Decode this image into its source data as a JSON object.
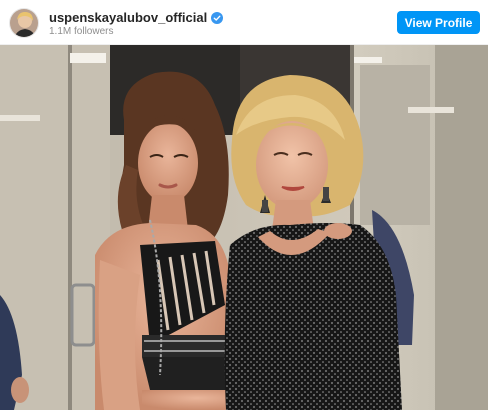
{
  "header": {
    "username": "uspenskayalubov_official",
    "followers": "1.1M followers",
    "view_profile_label": "View Profile",
    "verified_icon": "verified-badge-icon"
  },
  "post": {
    "media_type": "photo"
  },
  "colors": {
    "button": "#0095f6",
    "verified": "#3897f0",
    "username": "#262626",
    "followers": "#8e8e8e"
  }
}
